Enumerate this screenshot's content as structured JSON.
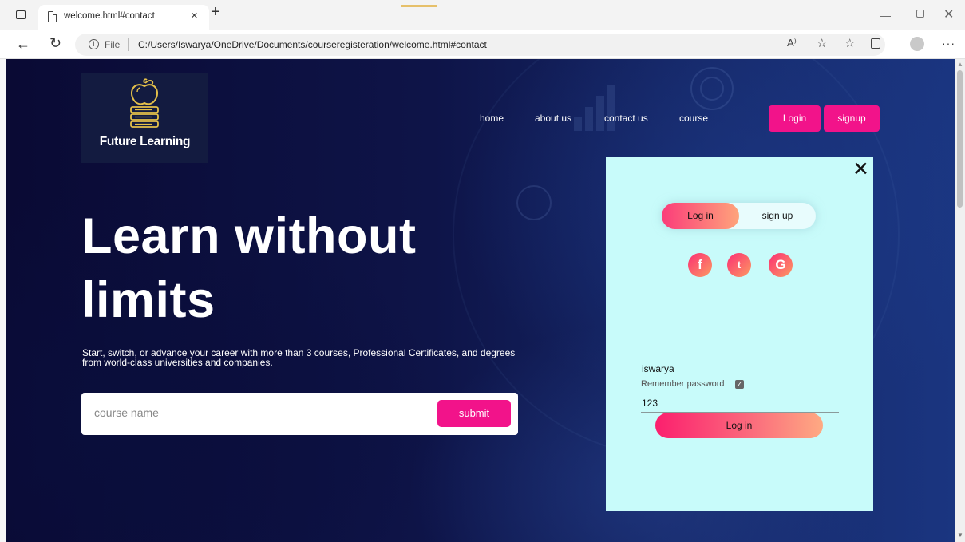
{
  "browser": {
    "tab_title": "welcome.html#contact",
    "tab_close": "×",
    "new_tab": "+",
    "file_label": "File",
    "url": "C:/Users/Iswarya/OneDrive/Documents/courseregisteration/welcome.html#contact",
    "read_aloud": "A⁾",
    "more": "···"
  },
  "logo": {
    "text": "Future Learning"
  },
  "nav": {
    "items": [
      "home",
      "about us",
      "contact us",
      "course"
    ],
    "login_label": "Login",
    "signup_label": "signup"
  },
  "hero": {
    "title": "Learn without limits",
    "subtitle": "Start, switch, or advance your career with more than 3 courses, Professional Certificates, and degrees from world-class universities and companies."
  },
  "search": {
    "placeholder": "course name",
    "submit_label": "submit"
  },
  "login_panel": {
    "close": "✕",
    "tab_login": "Log in",
    "tab_signup": "sign up",
    "social": [
      "f",
      "t",
      "G"
    ],
    "username_value": "iswarya",
    "password_value": "123",
    "remember_label": "Remember password",
    "remember_checked": true,
    "submit_label": "Log in"
  },
  "colors": {
    "accent": "#f2138a",
    "panel_bg": "#c8fbfa",
    "page_bg": "#0e1448"
  }
}
